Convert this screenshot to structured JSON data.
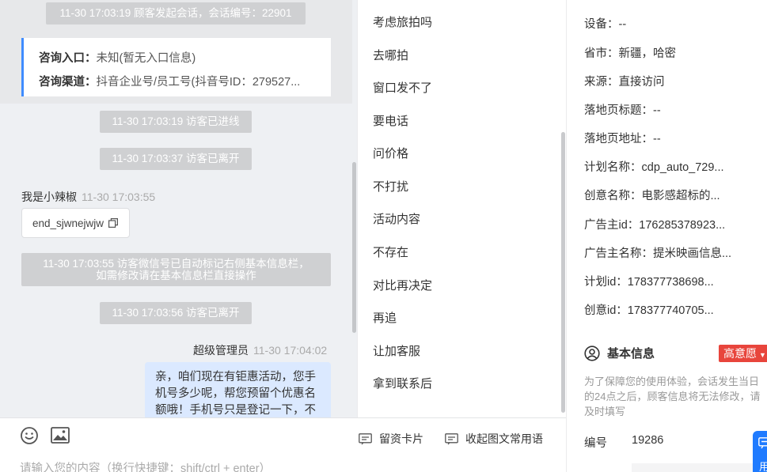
{
  "chat": {
    "session_start": "11-30 17:03:19 顾客发起会话，会话编号：22901",
    "info_card": {
      "entry_label": "咨询入口：",
      "entry_value": "未知(暂无入口信息)",
      "channel_label": "咨询渠道：",
      "channel_value": "抖音企业号/员工号(抖音号ID：279527..."
    },
    "events": [
      "11-30 17:03:19 访客已进线",
      "11-30 17:03:37 访客已离开"
    ],
    "visitor_name": "我是小辣椒",
    "visitor_time": "11-30 17:03:55",
    "visitor_message": "end_sjwnejwjw",
    "wechat_line1": "11-30 17:03:55 访客微信号已自动标记右侧基本信息栏，",
    "wechat_line2": "如需修改请在基本信息栏直接操作",
    "left_event": "11-30 17:03:56 访客已离开",
    "agent_name": "超级管理员",
    "agent_time": "11-30 17:04:02",
    "agent_message": "亲，咱们现在有钜惠活动，您手机号多少呢，帮您预留个优惠名额哦！手机号只是登记一下，不会频繁打扰您的，您放心"
  },
  "composer": {
    "leave_card": "留资卡片",
    "collapse_phrases": "收起图文常用语",
    "placeholder": "请输入您的内容（换行快捷键：shift/ctrl + enter）"
  },
  "quick_replies": [
    "考虑旅拍吗",
    "去哪拍",
    "窗口发不了",
    "要电话",
    "问价格",
    "不打扰",
    "活动内容",
    "不存在",
    "对比再决定",
    "再追",
    "让加客服",
    "拿到联系后"
  ],
  "detail": {
    "rows": [
      {
        "label": "设备：",
        "value": "--"
      },
      {
        "label": "省市：",
        "value": "新疆，哈密"
      },
      {
        "label": "来源：",
        "value": "直接访问"
      },
      {
        "label": "落地页标题：",
        "value": "--"
      },
      {
        "label": "落地页地址：",
        "value": "--"
      },
      {
        "label": "计划名称：",
        "value": "cdp_auto_729..."
      },
      {
        "label": "创意名称：",
        "value": "电影感超标的..."
      },
      {
        "label": "广告主id：",
        "value": "176285378923..."
      },
      {
        "label": "广告主名称：",
        "value": "提米映画信息..."
      },
      {
        "label": "计划id：",
        "value": "178377738698..."
      },
      {
        "label": "创意id：",
        "value": "178377740705..."
      }
    ],
    "basic_info_title": "基本信息",
    "intent_badge": "高意愿",
    "basic_note": "为了保障您的使用体验，会话发生当日的24点之后，顾客信息将无法修改，请及时填写",
    "serial_label": "编号",
    "serial_value": "19286",
    "float_label": "用"
  },
  "colors": {
    "accent": "#3f8cff",
    "agent_bubble": "#dbe9ff",
    "intent_badge": "#e8453c",
    "system_pill": "#cfd0d2"
  },
  "icons": [
    "emoji-icon",
    "image-icon",
    "card-icon",
    "chat-phrase-icon",
    "copy-icon",
    "user-circle-icon",
    "caret-down-icon",
    "message-icon"
  ]
}
